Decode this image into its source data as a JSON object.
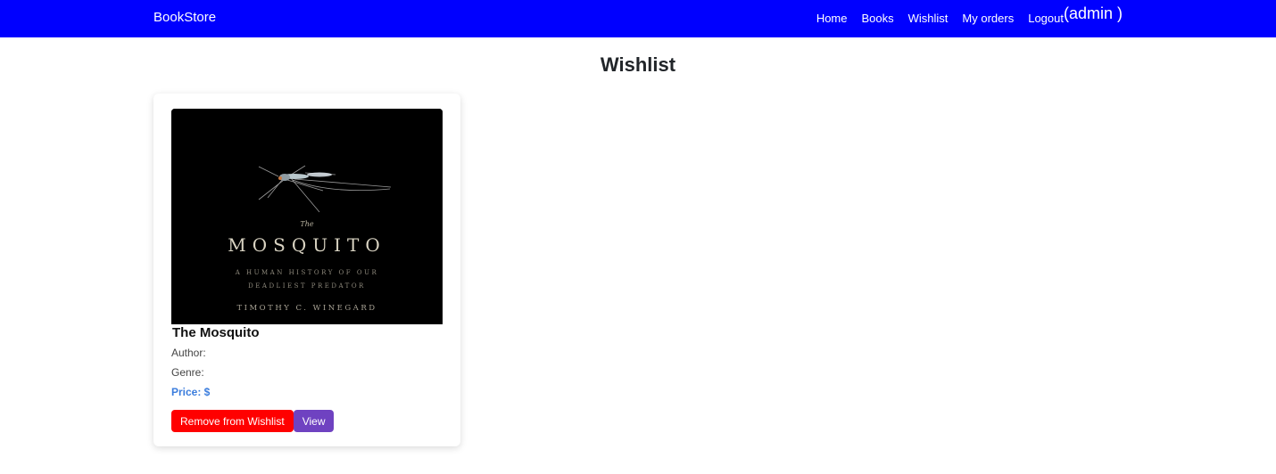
{
  "navbar": {
    "brand": "BookStore",
    "links": [
      "Home",
      "Books",
      "Wishlist",
      "My orders",
      "Logout"
    ],
    "user": "(admin )",
    "background": "#0000ff"
  },
  "page": {
    "title": "Wishlist"
  },
  "wishlist": {
    "items": [
      {
        "title": "The Mosquito",
        "author_label": "Author:",
        "genre_label": "Genre:",
        "price_label": "Price: $",
        "cover": {
          "small_title": "The",
          "big_title": "MOSQUITO",
          "subtitle_line1": "A HUMAN HISTORY OF OUR",
          "subtitle_line2": "DEADLIEST PREDATOR",
          "author": "TIMOTHY C. WINEGARD"
        },
        "remove_label": "Remove from Wishlist",
        "view_label": "View"
      }
    ]
  },
  "colors": {
    "remove_button": "#ff0000",
    "view_button": "#6f42c1",
    "price": "#3b7ddd"
  }
}
